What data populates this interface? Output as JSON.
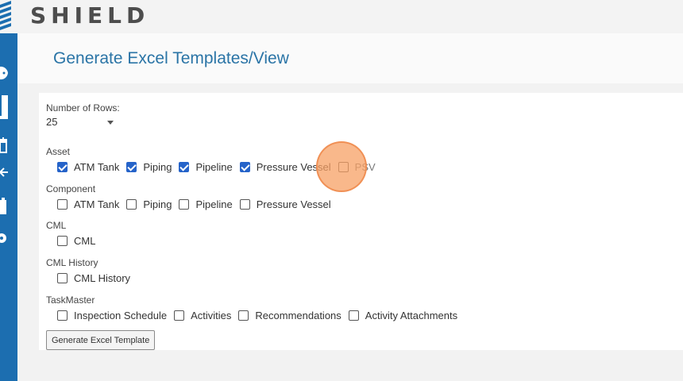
{
  "app": {
    "logo_text": "SHIELD"
  },
  "colors": {
    "sidebar": "#1c6eb0",
    "title": "#2a74a6",
    "checkbox_checked": "#2563c9",
    "highlight": "#f7a064"
  },
  "page": {
    "title": "Generate Excel Templates/View"
  },
  "rows": {
    "label": "Number of Rows:",
    "value": "25"
  },
  "sections": {
    "asset": {
      "label": "Asset",
      "items": [
        {
          "label": "ATM Tank",
          "checked": true
        },
        {
          "label": "Piping",
          "checked": true
        },
        {
          "label": "Pipeline",
          "checked": true
        },
        {
          "label": "Pressure Vessel",
          "checked": true
        },
        {
          "label": "PSV",
          "checked": false
        }
      ]
    },
    "component": {
      "label": "Component",
      "items": [
        {
          "label": "ATM Tank",
          "checked": false
        },
        {
          "label": "Piping",
          "checked": false
        },
        {
          "label": "Pipeline",
          "checked": false
        },
        {
          "label": "Pressure Vessel",
          "checked": false
        }
      ]
    },
    "cml": {
      "label": "CML",
      "items": [
        {
          "label": "CML",
          "checked": false
        }
      ]
    },
    "cml_history": {
      "label": "CML History",
      "items": [
        {
          "label": "CML History",
          "checked": false
        }
      ]
    },
    "taskmaster": {
      "label": "TaskMaster",
      "items": [
        {
          "label": "Inspection Schedule",
          "checked": false
        },
        {
          "label": "Activities",
          "checked": false
        },
        {
          "label": "Recommendations",
          "checked": false
        },
        {
          "label": "Activity Attachments",
          "checked": false
        }
      ]
    }
  },
  "button": {
    "generate_label": "Generate Excel Template"
  },
  "icons": [
    "logo-stripes-icon",
    "palette-icon",
    "building-icon",
    "calendar-icon",
    "arrow-left-icon",
    "clipboard-icon",
    "gear-icon"
  ]
}
